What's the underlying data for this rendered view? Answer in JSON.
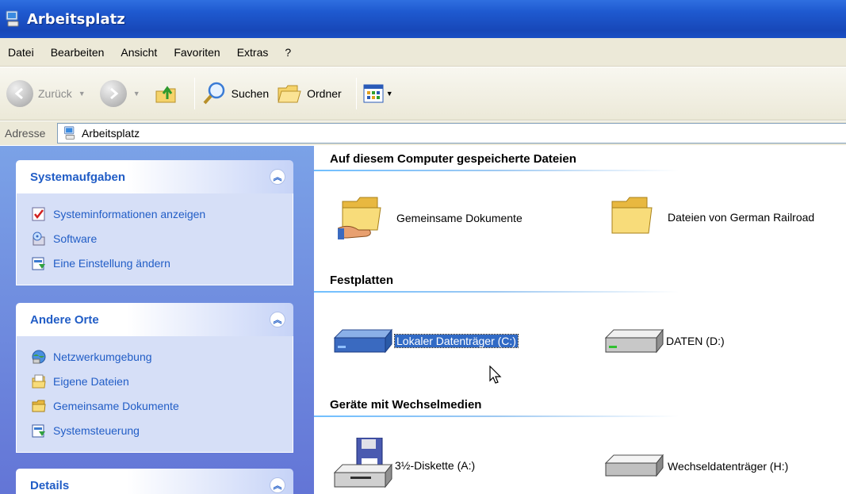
{
  "window": {
    "title": "Arbeitsplatz"
  },
  "menu": [
    "Datei",
    "Bearbeiten",
    "Ansicht",
    "Favoriten",
    "Extras",
    "?"
  ],
  "toolbar": {
    "back_label": "Zurück",
    "search_label": "Suchen",
    "folders_label": "Ordner"
  },
  "address": {
    "label": "Adresse",
    "value": "Arbeitsplatz"
  },
  "sidebar": {
    "system_tasks": {
      "title": "Systemaufgaben",
      "items": [
        {
          "label": "Systeminformationen anzeigen",
          "icon": "system-info-icon"
        },
        {
          "label": "Software",
          "icon": "software-icon"
        },
        {
          "label": "Eine Einstellung ändern",
          "icon": "control-panel-icon"
        }
      ]
    },
    "other_places": {
      "title": "Andere Orte",
      "items": [
        {
          "label": "Netzwerkumgebung",
          "icon": "network-icon"
        },
        {
          "label": "Eigene Dateien",
          "icon": "my-documents-icon"
        },
        {
          "label": "Gemeinsame Dokumente",
          "icon": "folder-icon"
        },
        {
          "label": "Systemsteuerung",
          "icon": "control-panel-icon"
        }
      ]
    },
    "details": {
      "title": "Details"
    }
  },
  "content": {
    "groups": [
      {
        "title": "Auf diesem Computer gespeicherte Dateien",
        "items": [
          {
            "label": "Gemeinsame Dokumente",
            "icon": "shared-folder-icon"
          },
          {
            "label": "Dateien von German Railroad",
            "icon": "folder-icon"
          }
        ]
      },
      {
        "title": "Festplatten",
        "items": [
          {
            "label": "Lokaler Datenträger (C:)",
            "icon": "hard-drive-icon",
            "selected": true
          },
          {
            "label": "DATEN (D:)",
            "icon": "hard-drive-icon"
          }
        ]
      },
      {
        "title": "Geräte mit Wechselmedien",
        "items": [
          {
            "label": "3½-Diskette (A:)",
            "icon": "floppy-drive-icon"
          },
          {
            "label": "Wechseldatenträger (H:)",
            "icon": "removable-drive-icon"
          }
        ]
      }
    ]
  },
  "colors": {
    "title_bar": "#1f5ad0",
    "task_link": "#215dc6",
    "selection": "#316ac5",
    "task_pane": "#6f8ee0"
  }
}
